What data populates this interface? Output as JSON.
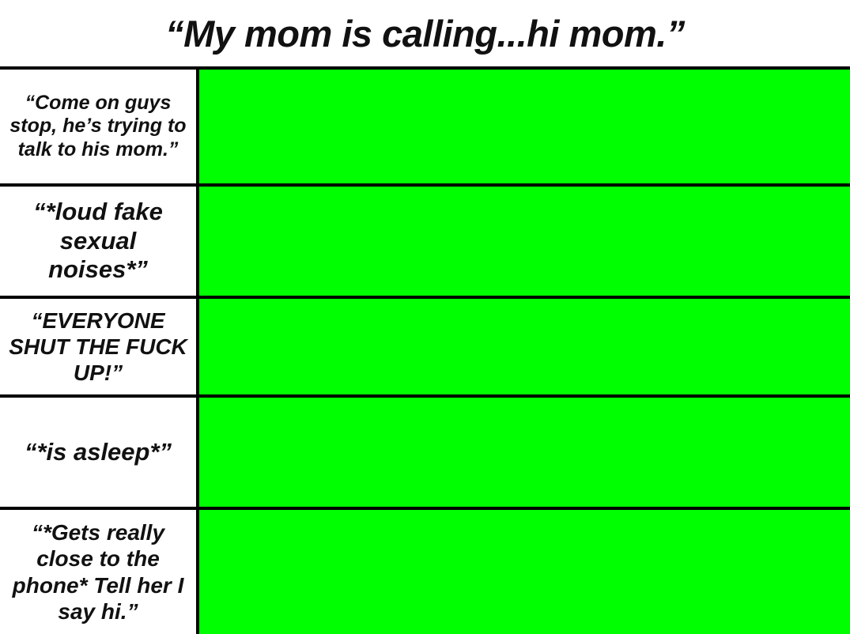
{
  "title": "“My mom is calling...hi mom.”",
  "colors": {
    "cell_fill": "#00ff00",
    "border": "#000000",
    "background": "#ffffff"
  },
  "rows": [
    {
      "label": "“Come on guys stop, he’s trying to talk to his mom.”"
    },
    {
      "label": "“*loud fake sexual noises*”"
    },
    {
      "label": "“EVERYONE SHUT THE FUCK UP!”"
    },
    {
      "label": "“*is asleep*”"
    },
    {
      "label": "“*Gets really close to the phone* Tell her I say hi.”"
    }
  ]
}
